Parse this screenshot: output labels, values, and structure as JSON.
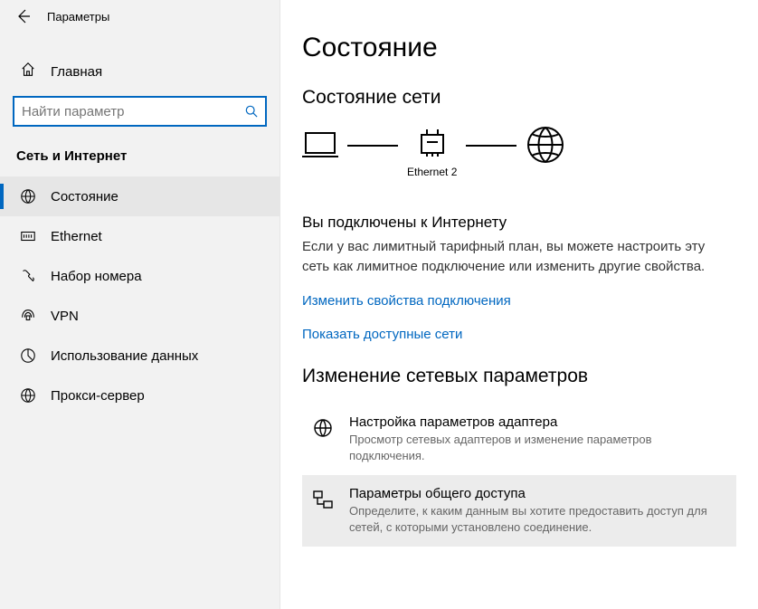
{
  "window": {
    "title": "Параметры"
  },
  "sidebar": {
    "home": "Главная",
    "search_placeholder": "Найти параметр",
    "section": "Сеть и Интернет",
    "items": [
      {
        "label": "Состояние"
      },
      {
        "label": "Ethernet"
      },
      {
        "label": "Набор номера"
      },
      {
        "label": "VPN"
      },
      {
        "label": "Использование данных"
      },
      {
        "label": "Прокси-сервер"
      }
    ]
  },
  "main": {
    "heading": "Состояние",
    "net_state_heading": "Состояние сети",
    "diagram": {
      "adapter_label": "Ethernet 2"
    },
    "connected_heading": "Вы подключены к Интернету",
    "connected_text": "Если у вас лимитный тарифный план, вы можете настроить эту сеть как лимитное подключение или изменить другие свойства.",
    "link_change_props": "Изменить свойства подключения",
    "link_show_networks": "Показать доступные сети",
    "change_params_heading": "Изменение сетевых параметров",
    "settings": [
      {
        "title": "Настройка параметров адаптера",
        "desc": "Просмотр сетевых адаптеров и изменение параметров подключения."
      },
      {
        "title": "Параметры общего доступа",
        "desc": "Определите, к каким данным вы хотите предоставить доступ для сетей, с которыми установлено соединение."
      }
    ]
  }
}
